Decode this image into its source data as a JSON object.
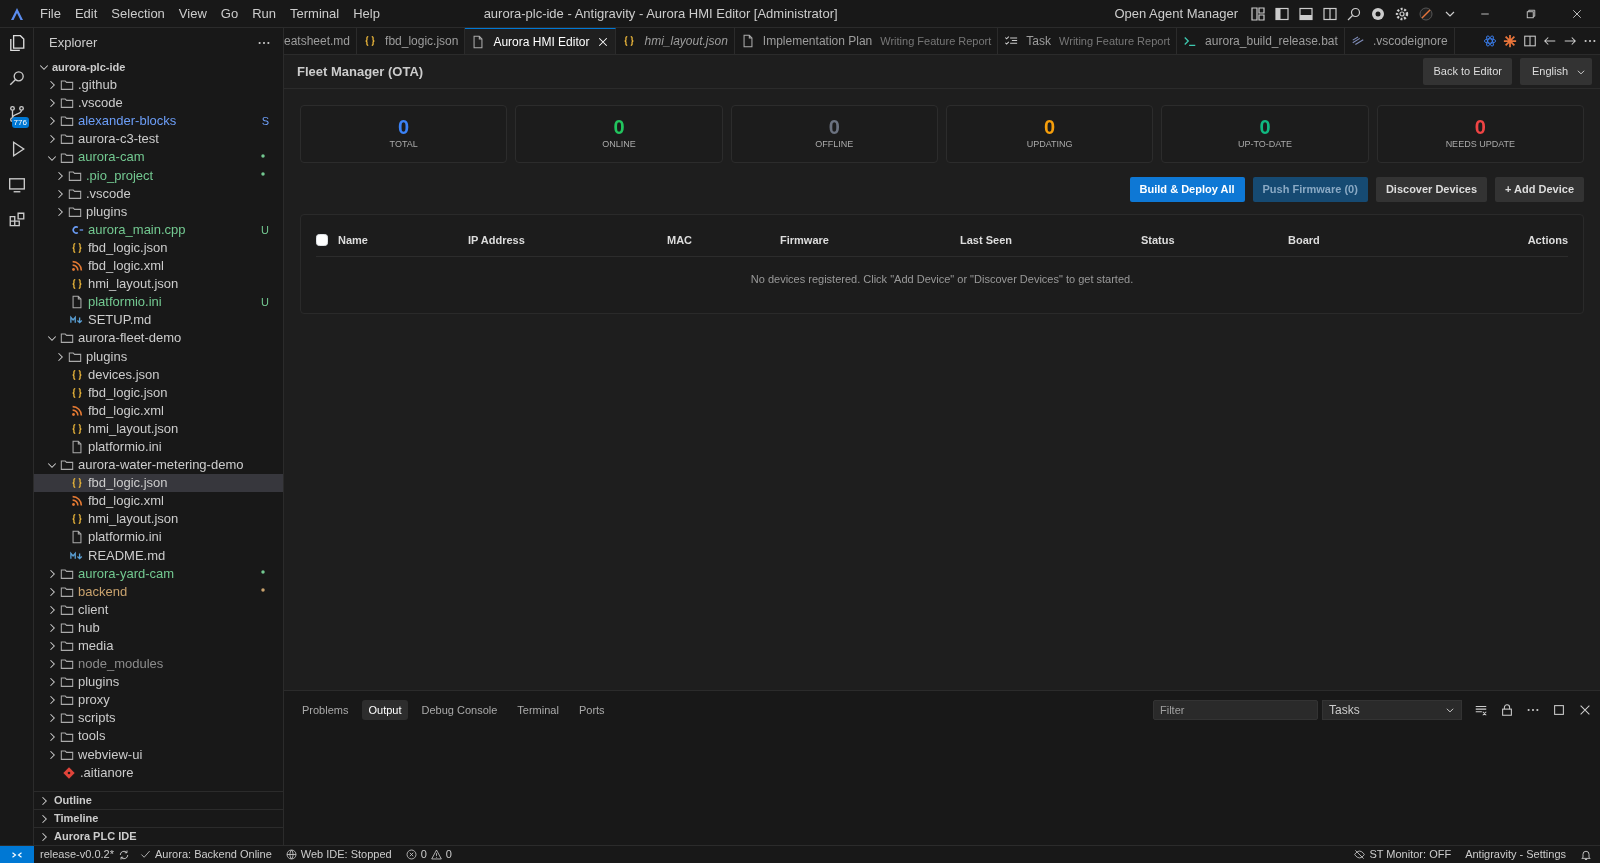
{
  "title_bar": {
    "menu": [
      "File",
      "Edit",
      "Selection",
      "View",
      "Go",
      "Run",
      "Terminal",
      "Help"
    ],
    "title": "aurora-plc-ide - Antigravity - Aurora HMI Editor [Administrator]",
    "agent_manager": "Open Agent Manager"
  },
  "activity_bar": {
    "source_control_badge": "776"
  },
  "sidebar": {
    "title": "Explorer",
    "tree": [
      {
        "label": "aurora-plc-ide",
        "kind": "root",
        "expanded": true,
        "children": [
          {
            "label": ".github",
            "kind": "folder",
            "expanded": false
          },
          {
            "label": ".vscode",
            "kind": "folder",
            "expanded": false
          },
          {
            "label": "alexander-blocks",
            "kind": "folder",
            "expanded": false,
            "color": "#6c9ef8",
            "badge": "S"
          },
          {
            "label": "aurora-c3-test",
            "kind": "folder",
            "expanded": false
          },
          {
            "label": "aurora-cam",
            "kind": "folder",
            "expanded": true,
            "color": "#73c991",
            "dot": true,
            "children": [
              {
                "label": ".pio_project",
                "kind": "folder",
                "expanded": false,
                "color": "#73c991",
                "dot": true
              },
              {
                "label": ".vscode",
                "kind": "folder",
                "expanded": false
              },
              {
                "label": "plugins",
                "kind": "folder",
                "expanded": false
              },
              {
                "label": "aurora_main.cpp",
                "kind": "cpp",
                "color": "#73c991",
                "badge": "U"
              },
              {
                "label": "fbd_logic.json",
                "kind": "json"
              },
              {
                "label": "fbd_logic.xml",
                "kind": "xml"
              },
              {
                "label": "hmi_layout.json",
                "kind": "json"
              },
              {
                "label": "platformio.ini",
                "kind": "file",
                "color": "#73c991",
                "badge": "U"
              },
              {
                "label": "SETUP.md",
                "kind": "md"
              }
            ]
          },
          {
            "label": "aurora-fleet-demo",
            "kind": "folder",
            "expanded": true,
            "children": [
              {
                "label": "plugins",
                "kind": "folder",
                "expanded": false
              },
              {
                "label": "devices.json",
                "kind": "json"
              },
              {
                "label": "fbd_logic.json",
                "kind": "json"
              },
              {
                "label": "fbd_logic.xml",
                "kind": "xml"
              },
              {
                "label": "hmi_layout.json",
                "kind": "json"
              },
              {
                "label": "platformio.ini",
                "kind": "file"
              }
            ]
          },
          {
            "label": "aurora-water-metering-demo",
            "kind": "folder",
            "expanded": true,
            "children": [
              {
                "label": "fbd_logic.json",
                "kind": "json",
                "selected": true
              },
              {
                "label": "fbd_logic.xml",
                "kind": "xml"
              },
              {
                "label": "hmi_layout.json",
                "kind": "json"
              },
              {
                "label": "platformio.ini",
                "kind": "file"
              },
              {
                "label": "README.md",
                "kind": "md"
              }
            ]
          },
          {
            "label": "aurora-yard-cam",
            "kind": "folder",
            "expanded": false,
            "color": "#73c991",
            "dot": true
          },
          {
            "label": "backend",
            "kind": "folder",
            "expanded": false,
            "color": "#c9a26d",
            "dot": true
          },
          {
            "label": "client",
            "kind": "folder",
            "expanded": false
          },
          {
            "label": "hub",
            "kind": "folder",
            "expanded": false
          },
          {
            "label": "media",
            "kind": "folder",
            "expanded": false
          },
          {
            "label": "node_modules",
            "kind": "folder",
            "expanded": false,
            "color": "#8c8c8c"
          },
          {
            "label": "plugins",
            "kind": "folder",
            "expanded": false
          },
          {
            "label": "proxy",
            "kind": "folder",
            "expanded": false
          },
          {
            "label": "scripts",
            "kind": "folder",
            "expanded": false
          },
          {
            "label": "tools",
            "kind": "folder",
            "expanded": false
          },
          {
            "label": "webview-ui",
            "kind": "folder",
            "expanded": false
          },
          {
            "label": ".aitianore",
            "kind": "git"
          }
        ]
      }
    ],
    "sections": [
      {
        "label": "Outline",
        "expanded": false
      },
      {
        "label": "Timeline",
        "expanded": false
      },
      {
        "label": "Aurora PLC IDE",
        "expanded": false
      }
    ]
  },
  "tabs": [
    {
      "label": "eatsheet.md",
      "kind": "none",
      "selected": false,
      "italic": false
    },
    {
      "label": "fbd_logic.json",
      "kind": "json",
      "selected": false,
      "italic": false
    },
    {
      "label": "Aurora HMI Editor",
      "kind": "file",
      "selected": true,
      "italic": false
    },
    {
      "label": "hmi_layout.json",
      "kind": "json",
      "selected": false,
      "italic": true
    },
    {
      "label": "Implementation Plan",
      "description": "Writing Feature Report",
      "kind": "file",
      "selected": false,
      "italic": false
    },
    {
      "label": "Task",
      "description": "Writing Feature Report",
      "kind": "checklist",
      "selected": false,
      "italic": false
    },
    {
      "label": "aurora_build_release.bat",
      "kind": "terminal",
      "selected": false,
      "italic": false
    },
    {
      "label": ".vscodeignore",
      "kind": "ignore",
      "selected": false,
      "italic": false
    }
  ],
  "fleet_manager": {
    "title": "Fleet Manager (OTA)",
    "back_button": "Back to Editor",
    "language": "English",
    "stats": [
      {
        "value": "0",
        "label": "TOTAL",
        "color": "#3b82f6"
      },
      {
        "value": "0",
        "label": "ONLINE",
        "color": "#22c55e"
      },
      {
        "value": "0",
        "label": "OFFLINE",
        "color": "#6b7280"
      },
      {
        "value": "0",
        "label": "UPDATING",
        "color": "#f59e0b"
      },
      {
        "value": "0",
        "label": "UP-TO-DATE",
        "color": "#10b981"
      },
      {
        "value": "0",
        "label": "NEEDS UPDATE",
        "color": "#ef4444"
      }
    ],
    "actions": [
      {
        "label": "Build & Deploy All",
        "kind": "primary",
        "disabled": false
      },
      {
        "label": "Push Firmware (0)",
        "kind": "primary",
        "disabled": true
      },
      {
        "label": "Discover Devices",
        "kind": "secondary",
        "disabled": false
      },
      {
        "label": "+ Add Device",
        "kind": "secondary",
        "disabled": false
      }
    ],
    "table": {
      "select_all_checked": false,
      "columns": [
        "Name",
        "IP Address",
        "MAC",
        "Firmware",
        "Last Seen",
        "Status",
        "Board",
        "Actions"
      ],
      "empty_message": "No devices registered. Click \"Add Device\" or \"Discover Devices\" to get started."
    }
  },
  "panel": {
    "tabs": [
      {
        "label": "Problems",
        "selected": false
      },
      {
        "label": "Output",
        "selected": true
      },
      {
        "label": "Debug Console",
        "selected": false
      },
      {
        "label": "Terminal",
        "selected": false
      },
      {
        "label": "Ports",
        "selected": false
      }
    ],
    "filter_placeholder": "Filter",
    "channel": "Tasks"
  },
  "status_bar": {
    "branch": "release-v0.0.2*",
    "backend": "Aurora: Backend Online",
    "web_ide": "Web IDE: Stopped",
    "errors": "0",
    "warnings": "0",
    "st_monitor": "ST Monitor: OFF",
    "settings": "Antigravity - Settings"
  }
}
